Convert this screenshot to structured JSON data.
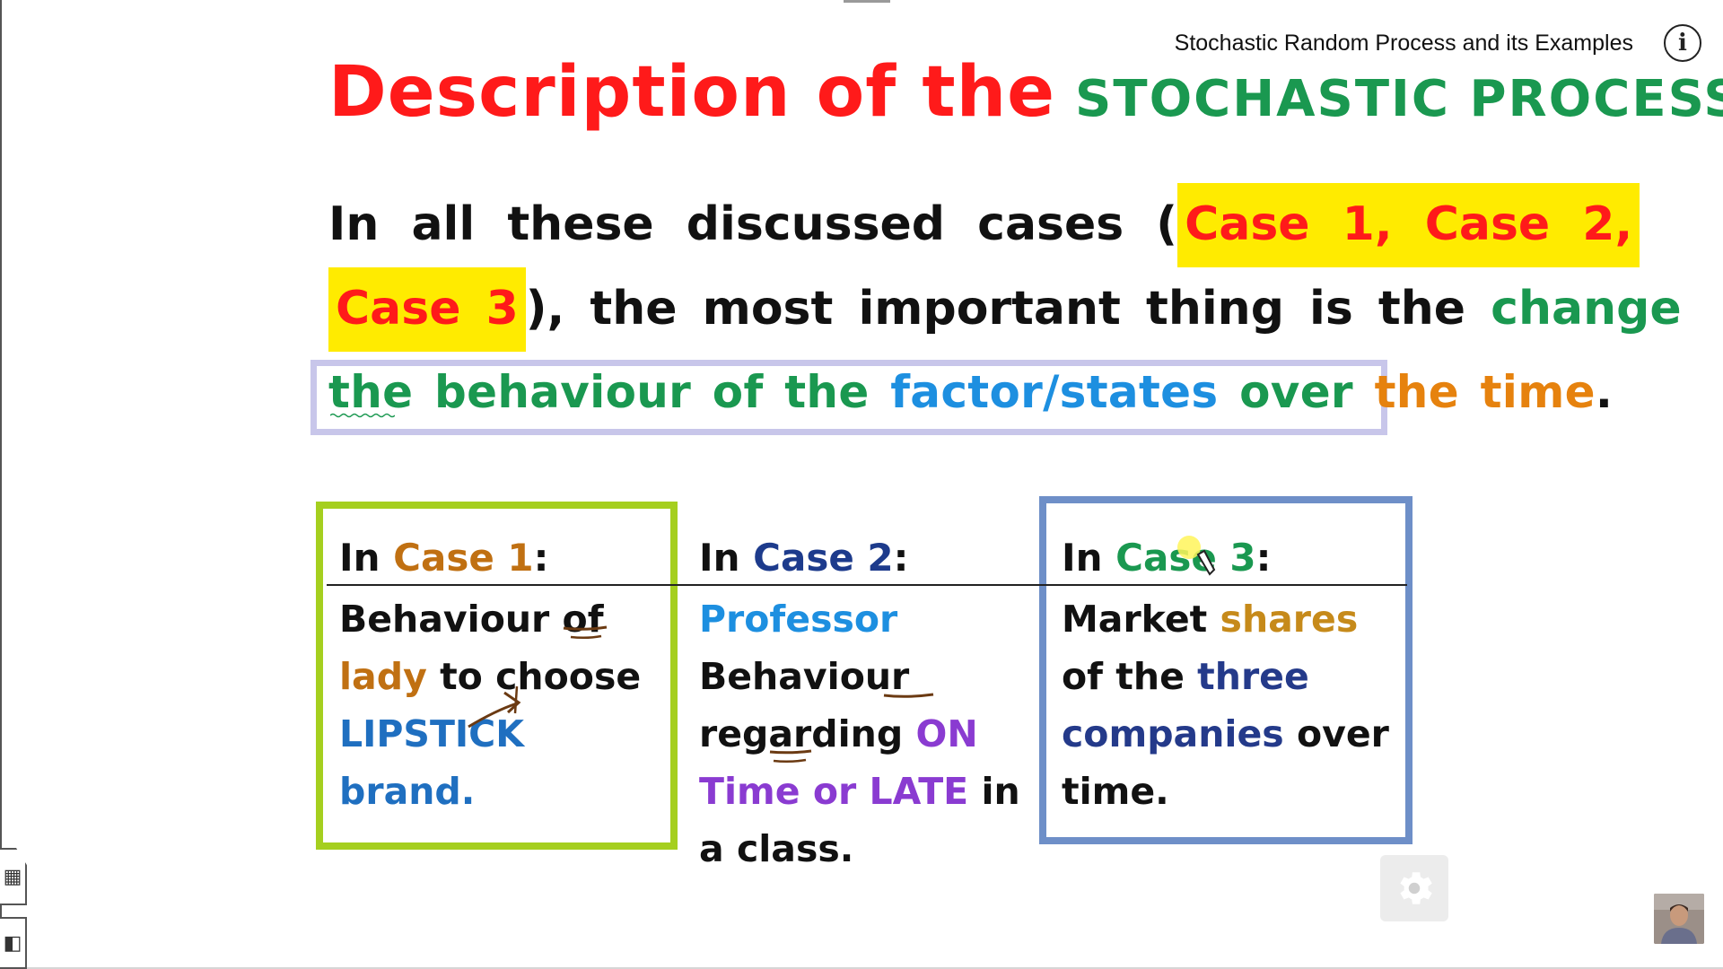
{
  "player": {
    "video_title": "Stochastic Random Process and its Examples",
    "info_icon": "info-icon",
    "info_glyph": "i",
    "settings_icon": "gear-icon",
    "channel_avatar": "avatar"
  },
  "side_tools": {
    "table_icon": "table-icon",
    "table_glyph": "▦",
    "panel_icon": "panel-icon",
    "panel_glyph": "◧"
  },
  "slide": {
    "title_part1": "Description of the",
    "title_part2": "STOCHASTIC PROCESS",
    "line1_prefix": "In all these discussed cases (",
    "line1_highlight": "Case 1, Case 2,",
    "line2_highlight": "Case 3",
    "line2_middle": "), the most important thing is the",
    "line2_change": "change",
    "line3_the": "the",
    "line3_behaviour": "behaviour of the",
    "line3_factor": "factor/states",
    "line3_over": "over",
    "line3_time": "the time",
    "line3_period": ".",
    "case1": {
      "head_prefix": "In",
      "head_case": "Case 1",
      "head_colon": ":",
      "body_1": "Behaviour of",
      "body_lady": "lady",
      "body_2": "to choose",
      "body_lipstick": "LIPSTICK",
      "body_brand": "brand."
    },
    "case2": {
      "head_prefix": "In",
      "head_case": "Case 2",
      "head_colon": ":",
      "body_professor": "Professor",
      "body_1": "Behaviour regarding",
      "body_ontime": "ON Time",
      "body_or": "or",
      "body_late": "LATE",
      "body_2": "in a class."
    },
    "case3": {
      "head_prefix": "In",
      "head_case": "Case 3",
      "head_colon": ":",
      "body_1": "Market",
      "body_shares": "shares",
      "body_2": "of the",
      "body_companies": "three companies",
      "body_3": "over time."
    }
  },
  "colors": {
    "title_red": "#ff1a1a",
    "title_green": "#1a9850",
    "highlight_yellow": "#ffeb00",
    "box1_border": "#a5cf1f",
    "box3_border": "#6e8fc8",
    "frame_lavender": "#c8c6ea"
  }
}
